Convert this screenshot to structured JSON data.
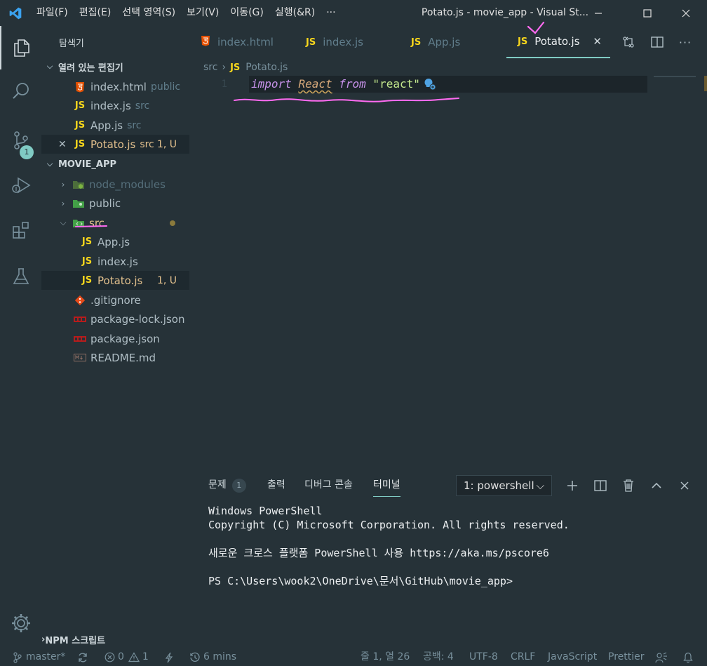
{
  "window": {
    "title": "Potato.js - movie_app - Visual St...",
    "menu": [
      "파일(F)",
      "편집(E)",
      "선택 영역(S)",
      "보기(V)",
      "이동(G)",
      "실행(&R)",
      "···"
    ]
  },
  "activity": {
    "scm_badge": "1"
  },
  "sidebar": {
    "title": "탐색기",
    "open_editors_label": "열려 있는 편집기",
    "open_editors": [
      {
        "icon": "html5-icon",
        "name": "index.html",
        "desc": "public"
      },
      {
        "icon": "js-icon",
        "name": "index.js",
        "desc": "src"
      },
      {
        "icon": "js-icon",
        "name": "App.js",
        "desc": "src"
      },
      {
        "icon": "js-icon",
        "name": "Potato.js",
        "desc": "src",
        "status": "1, U"
      }
    ],
    "project_label": "MOVIE_APP",
    "tree": [
      {
        "name": "node_modules"
      },
      {
        "name": "public"
      },
      {
        "name": "src"
      },
      {
        "name": "App.js"
      },
      {
        "name": "index.js"
      },
      {
        "name": "Potato.js",
        "status": "1, U"
      },
      {
        "name": ".gitignore"
      },
      {
        "name": "package-lock.json"
      },
      {
        "name": "package.json"
      },
      {
        "name": "README.md"
      }
    ],
    "npm_label": "NPM 스크립트"
  },
  "tabs": [
    {
      "icon": "html5-icon",
      "label": "index.html"
    },
    {
      "icon": "js-icon",
      "label": "index.js"
    },
    {
      "icon": "js-icon",
      "label": "App.js"
    },
    {
      "icon": "js-icon",
      "label": "Potato.js",
      "active": true
    }
  ],
  "js_badge": "JS",
  "breadcrumb": {
    "folder": "src",
    "file": "Potato.js"
  },
  "editor": {
    "line_number": "1",
    "tokens": {
      "import": "import",
      "react": "React",
      "from": "from",
      "module": "\"react\""
    }
  },
  "panel": {
    "tabs": [
      {
        "label": "문제",
        "count": "1"
      },
      {
        "label": "출력"
      },
      {
        "label": "디버그 콘솔"
      },
      {
        "label": "터미널",
        "active": true
      }
    ],
    "terminal_select": "1: powershell",
    "terminal_lines": [
      "Windows PowerShell",
      "Copyright (C) Microsoft Corporation. All rights reserved.",
      "새로운 크로스 플랫폼 PowerShell 사용 https://aka.ms/pscore6",
      "PS C:\\Users\\wook2\\OneDrive\\문서\\GitHub\\movie_app>"
    ]
  },
  "statusbar": {
    "branch": "master*",
    "errors": "0",
    "warnings": "1",
    "time": "6 mins",
    "position": "줄 1, 열 26",
    "spaces": "공백: 4",
    "encoding": "UTF-8",
    "eol": "CRLF",
    "language": "JavaScript",
    "formatter": "Prettier"
  },
  "colors": {
    "background": "#263238",
    "accent": "#80cbc4",
    "js_yellow": "#f9d71c",
    "annotation_pink": "#ff6bf1"
  }
}
